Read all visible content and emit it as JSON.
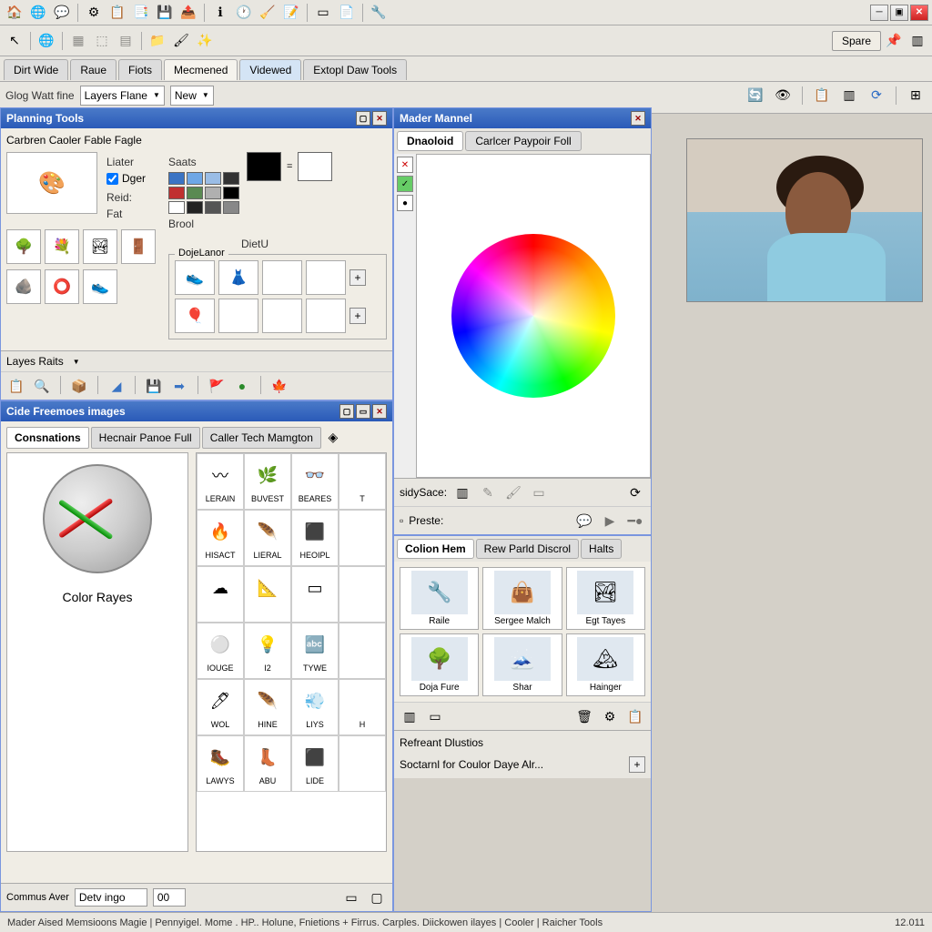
{
  "window": {
    "spare": "Spare"
  },
  "tabs": {
    "row": [
      "Dirt Wide",
      "Raue",
      "Fiots",
      "Mecmened",
      "Videwed",
      "Extopl Daw Tools"
    ],
    "active": 3
  },
  "subtoolbar": {
    "glog": "Glog Watt fine",
    "combo1": "Layers Flane",
    "combo2": "New"
  },
  "planning": {
    "title": "Planning Tools",
    "header": "Carbren Caoler Fable Fagle",
    "liater": "Liater",
    "dger": "Dger",
    "reid": "Reid:",
    "fat": "Fat",
    "saats": "Saats",
    "brool": "Brool",
    "dietu": "DietU",
    "dojelanor": "DojeLanor",
    "swatch_colors": [
      "#3a74c4",
      "#6ea7e6",
      "#9abde6",
      "#333",
      "#c03030",
      "#5a8a52",
      "#b0b0b0",
      "#000",
      "#fff",
      "#222",
      "#555",
      "#888"
    ],
    "big_swatch": "#000",
    "layes_raits": "Layes Raits"
  },
  "images_panel": {
    "title": "Cide Freemoes images",
    "tabs": [
      "Consnations",
      "Hecnair Panoe Full",
      "Caller Tech Mamgton"
    ],
    "active_tab": 0,
    "color_rayes": "Color Rayes",
    "grid": [
      "LERAIN",
      "BUVEST",
      "BEARES",
      "T",
      "HISACT",
      "LIERAL",
      "HEOIPL",
      "",
      "",
      "",
      "",
      "",
      "IOUGE",
      "I2",
      "TYWE",
      "",
      "WOL",
      "HINE",
      "LIYS",
      "H",
      "LAWYS",
      "ABU",
      "LIDE",
      ""
    ],
    "commus": "Commus Aver",
    "detv": "Detv ingo",
    "num": "00"
  },
  "mader": {
    "title": "Mader Mannel",
    "tabs": [
      "Dnaoloid",
      "Carlcer Paypoir Foll"
    ],
    "active": 0,
    "sidy": "sidySace:",
    "preste": "Preste:"
  },
  "presets": {
    "tabs": [
      "Colion Hem",
      "Rew Parld Discrol",
      "Halts"
    ],
    "active": 0,
    "cards": [
      {
        "label": "Raile"
      },
      {
        "label": "Sergee Malch"
      },
      {
        "label": "Egt Tayes"
      },
      {
        "label": "Doja Fure"
      },
      {
        "label": "Shar"
      },
      {
        "label": "Hainger"
      }
    ],
    "refreant": "Refreant Dlustios",
    "soctarnl": "Soctarnl for Coulor Daye Alr..."
  },
  "status": {
    "left": "Mader Aised Memsioons Magie  |  Pennyigel. Mome . HP.. Holune, Fnietions + Firrus. Carples. Diickowen ilayes |  Cooler | Raicher Tools",
    "right": "12.011"
  }
}
